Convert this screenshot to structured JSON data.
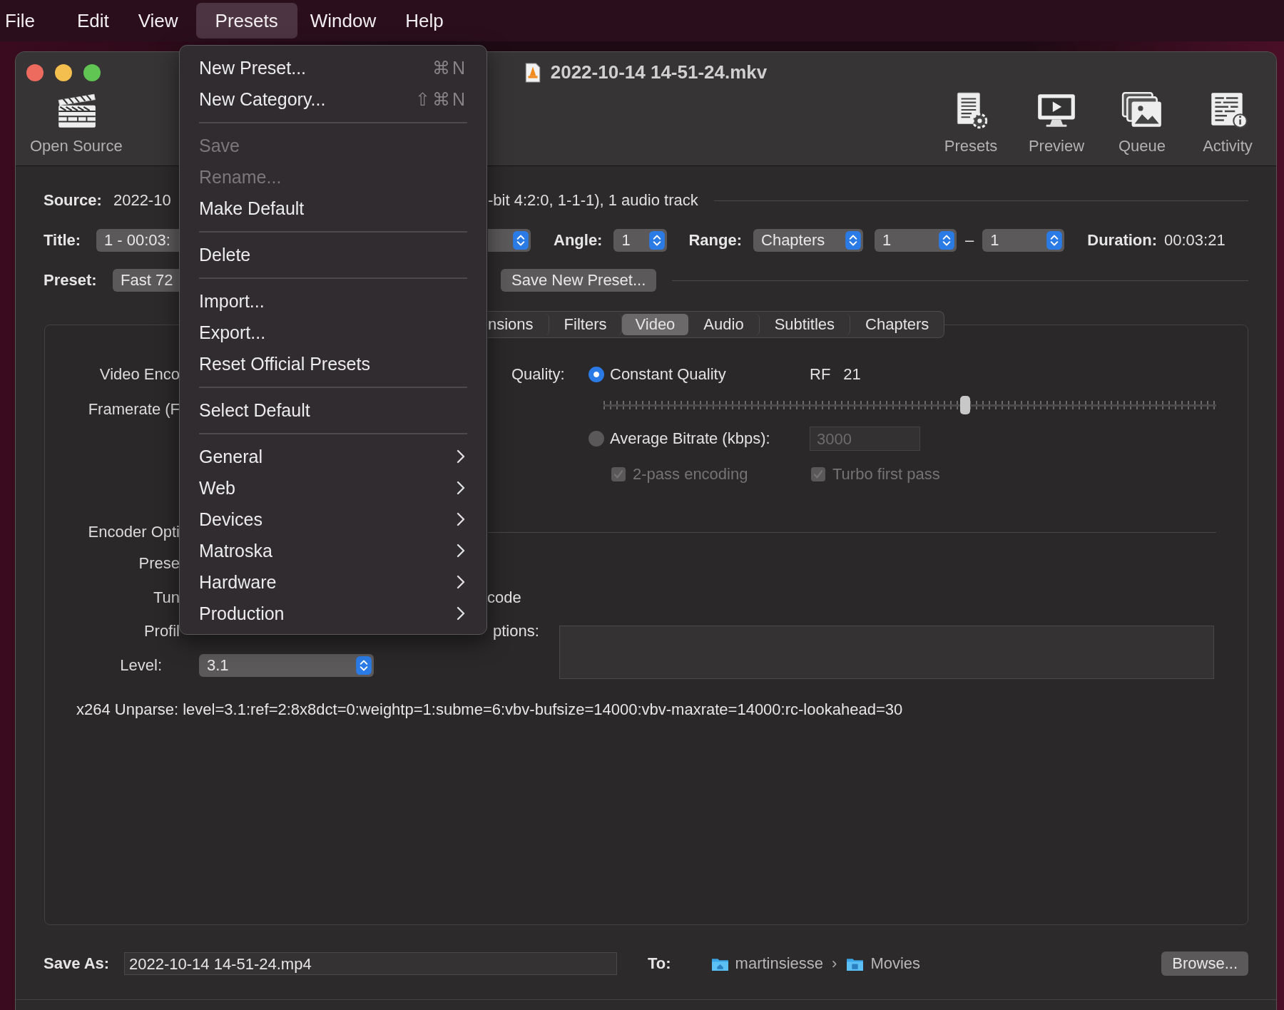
{
  "menu_bar": {
    "items": [
      {
        "label": "File",
        "selected": false
      },
      {
        "label": "Edit",
        "selected": false
      },
      {
        "label": "View",
        "selected": false
      },
      {
        "label": "Presets",
        "selected": true
      },
      {
        "label": "Window",
        "selected": false
      },
      {
        "label": "Help",
        "selected": false
      }
    ]
  },
  "window": {
    "title": "2022-10-14 14-51-24.mkv",
    "toolbar": [
      {
        "kind": "open_source",
        "label": "Open Source"
      },
      {
        "kind": "presets",
        "label": "Presets"
      },
      {
        "kind": "preview",
        "label": "Preview"
      },
      {
        "kind": "queue",
        "label": "Queue"
      },
      {
        "kind": "activity",
        "label": "Activity"
      }
    ]
  },
  "source": {
    "label": "Source:",
    "text_left": "2022-10",
    "text_right": "-bit 4:2:0, 1-1-1), 1 audio track"
  },
  "title_row": {
    "label": "Title:",
    "popup": "1 - 00:03:",
    "angle_label": "Angle:",
    "angle": "1",
    "range_label": "Range:",
    "range_mode": "Chapters",
    "range_from": "1",
    "range_dash": "–",
    "range_to": "1",
    "duration_label": "Duration:",
    "duration": "00:03:21"
  },
  "preset_row": {
    "label": "Preset:",
    "popup": "Fast 72",
    "save_button": "Save New Preset..."
  },
  "tabs": [
    {
      "label": "nsions",
      "selected": false
    },
    {
      "label": "Filters",
      "selected": false
    },
    {
      "label": "Video",
      "selected": true
    },
    {
      "label": "Audio",
      "selected": false
    },
    {
      "label": "Subtitles",
      "selected": false
    },
    {
      "label": "Chapters",
      "selected": false
    }
  ],
  "video": {
    "left_labels": [
      "Video Enco",
      "Framerate (F",
      "Encoder Opti",
      "Prese",
      "Tun",
      "Profil"
    ],
    "quality_label": "Quality:",
    "modes": [
      {
        "label": "Constant Quality",
        "selected": true
      },
      {
        "label": "Average Bitrate (kbps):",
        "selected": false
      }
    ],
    "rf_label": "RF",
    "rf_value": "21",
    "slider": {
      "level": 0.59
    },
    "bitrate": {
      "value": "3000",
      "disabled": true
    },
    "checkboxes": [
      {
        "label": "2-pass encoding",
        "checked": true,
        "disabled": true
      },
      {
        "label": "Turbo first pass",
        "checked": true,
        "disabled": true
      }
    ],
    "fragment_right": "code",
    "options_label": "ptions:",
    "level_label": "Level:",
    "level_value": "3.1",
    "unparse": "x264 Unparse: level=3.1:ref=2:8x8dct=0:weightp=1:subme=6:vbv-bufsize=14000:vbv-maxrate=14000:rc-lookahead=30"
  },
  "save_as": {
    "label": "Save As:",
    "value": "2022-10-14 14-51-24.mp4",
    "to_label": "To:",
    "path": [
      {
        "kind": "home",
        "label": "martinsiesse"
      },
      {
        "kind": "movies",
        "label": "Movies"
      }
    ],
    "path_separator": "›",
    "browse_button": "Browse..."
  },
  "presets_menu": {
    "items": [
      {
        "kind": "item",
        "label": "New Preset...",
        "shortcut": "⌘N",
        "disabled": false
      },
      {
        "kind": "item",
        "label": "New Category...",
        "shortcut": "⇧⌘N",
        "disabled": false
      },
      {
        "kind": "separator"
      },
      {
        "kind": "item",
        "label": "Save",
        "disabled": true
      },
      {
        "kind": "item",
        "label": "Rename...",
        "disabled": true
      },
      {
        "kind": "item",
        "label": "Make Default",
        "disabled": false
      },
      {
        "kind": "separator"
      },
      {
        "kind": "item",
        "label": "Delete",
        "disabled": false
      },
      {
        "kind": "separator"
      },
      {
        "kind": "item",
        "label": "Import...",
        "disabled": false
      },
      {
        "kind": "item",
        "label": "Export...",
        "disabled": false
      },
      {
        "kind": "item",
        "label": "Reset Official Presets",
        "disabled": false
      },
      {
        "kind": "separator"
      },
      {
        "kind": "item",
        "label": "Select Default",
        "disabled": false
      },
      {
        "kind": "separator"
      },
      {
        "kind": "submenu",
        "label": "General",
        "disabled": false
      },
      {
        "kind": "submenu",
        "label": "Web",
        "disabled": false
      },
      {
        "kind": "submenu",
        "label": "Devices",
        "disabled": false
      },
      {
        "kind": "submenu",
        "label": "Matroska",
        "disabled": false
      },
      {
        "kind": "submenu",
        "label": "Hardware",
        "disabled": false
      },
      {
        "kind": "submenu",
        "label": "Production",
        "disabled": false
      }
    ]
  }
}
